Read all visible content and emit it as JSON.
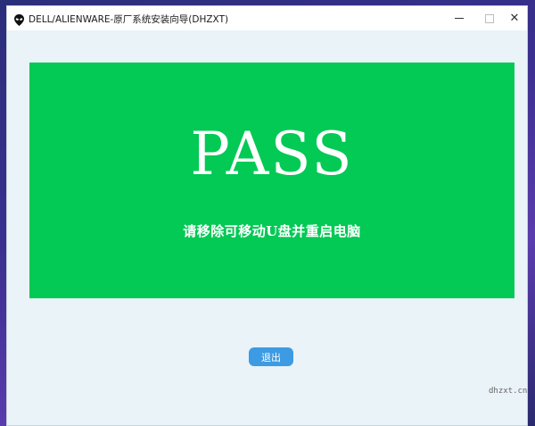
{
  "window": {
    "title": "DELL/ALIENWARE-原厂系统安装向导(DHZXT)",
    "icon": "alien-head-icon",
    "controls": {
      "minimize_icon": "minimize-icon",
      "maximize_icon": "maximize-icon",
      "close_icon": "close-icon",
      "close_glyph": "✕"
    }
  },
  "result_panel": {
    "status_text": "PASS",
    "message": "请移除可移动U盘并重启电脑",
    "color": "#03c955"
  },
  "exit_button": {
    "label": "退出",
    "color": "#3d9be3"
  },
  "watermark": "dhzxt.cn"
}
